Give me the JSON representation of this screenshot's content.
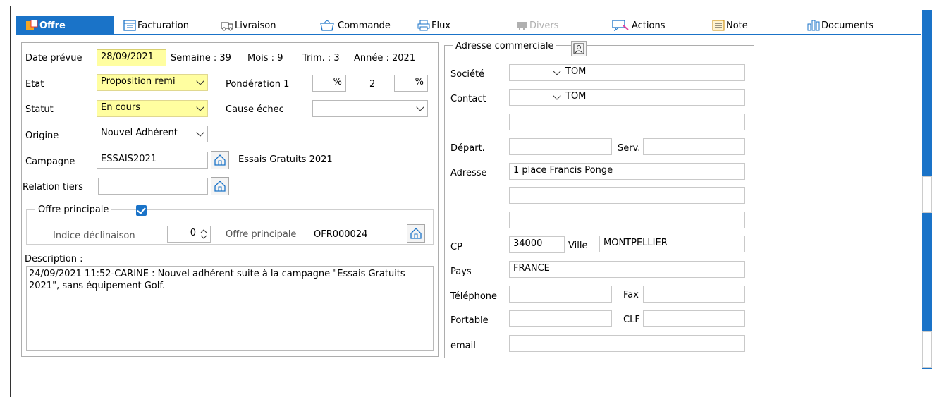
{
  "tabs": [
    {
      "label": "Offre",
      "icon": "offer-icon",
      "active": true
    },
    {
      "label": "Facturation",
      "icon": "invoice-icon"
    },
    {
      "label": "Livraison",
      "icon": "delivery-icon"
    },
    {
      "label": "Commande",
      "icon": "order-bag-icon"
    },
    {
      "label": "Flux",
      "icon": "printer-icon"
    },
    {
      "label": "Divers",
      "icon": "misc-icon",
      "disabled": true
    },
    {
      "label": "Actions",
      "icon": "actions-icon"
    },
    {
      "label": "Note",
      "icon": "note-icon"
    },
    {
      "label": "Documents",
      "icon": "documents-icon"
    }
  ],
  "left": {
    "date_label": "Date prévue",
    "date_value": "28/09/2021",
    "semaine": "Semaine : 39",
    "mois": "Mois : 9",
    "trim": "Trim. : 3",
    "annee": "Année : 2021",
    "etat_label": "Etat",
    "etat_value": "Proposition remi",
    "ponderation_label": "Pondération 1",
    "ponderation_1": "%",
    "ponderation_2_label": "2",
    "ponderation_2": "%",
    "statut_label": "Statut",
    "statut_value": "En cours",
    "cause_label": "Cause échec",
    "cause_value": "",
    "origine_label": "Origine",
    "origine_value": "Nouvel Adhérent",
    "campagne_label": "Campagne",
    "campagne_value": "ESSAIS2021",
    "campagne_desc": "Essais Gratuits 2021",
    "relation_label": "Relation tiers",
    "relation_value": "",
    "offre_principale_title": "Offre principale",
    "offre_principale_checked": true,
    "indice_label": "Indice déclinaison",
    "indice_value": "0",
    "offre_principale_label": "Offre principale",
    "offre_principale_value": "OFR000024",
    "description_label": "Description :",
    "description_text": "24/09/2021 11:52-CARINE : Nouvel adhérent suite à la campagne \"Essais Gratuits 2021\", sans équipement Golf."
  },
  "right": {
    "title": "Adresse commerciale",
    "societe_label": "Société",
    "societe_value": "TOM",
    "contact_label": "Contact",
    "contact_value": "TOM",
    "extra_line": "",
    "depart_label": "Départ.",
    "depart_value": "",
    "serv_label": "Serv.",
    "serv_value": "",
    "adresse_label": "Adresse",
    "adresse_1": "1 place Francis Ponge",
    "adresse_2": "",
    "adresse_3": "",
    "cp_label": "CP",
    "cp_value": "34000",
    "ville_label": "Ville",
    "ville_value": "MONTPELLIER",
    "pays_label": "Pays",
    "pays_value": "FRANCE",
    "tel_label": "Téléphone",
    "tel_value": "",
    "fax_label": "Fax",
    "fax_value": "",
    "portable_label": "Portable",
    "portable_value": "",
    "clf_label": "CLF",
    "clf_value": "",
    "email_label": "email",
    "email_value": ""
  },
  "colors": {
    "accent": "#1a73c8",
    "required_field": "#fffea0"
  }
}
